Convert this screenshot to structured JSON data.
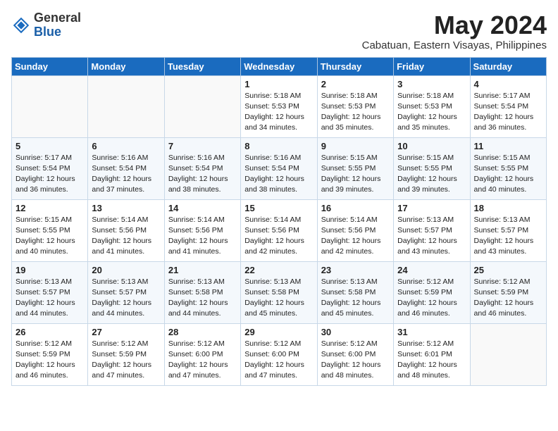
{
  "header": {
    "logo_line1": "General",
    "logo_line2": "Blue",
    "month_year": "May 2024",
    "location": "Cabatuan, Eastern Visayas, Philippines"
  },
  "days_of_week": [
    "Sunday",
    "Monday",
    "Tuesday",
    "Wednesday",
    "Thursday",
    "Friday",
    "Saturday"
  ],
  "weeks": [
    [
      {
        "day": "",
        "info": ""
      },
      {
        "day": "",
        "info": ""
      },
      {
        "day": "",
        "info": ""
      },
      {
        "day": "1",
        "info": "Sunrise: 5:18 AM\nSunset: 5:53 PM\nDaylight: 12 hours\nand 34 minutes."
      },
      {
        "day": "2",
        "info": "Sunrise: 5:18 AM\nSunset: 5:53 PM\nDaylight: 12 hours\nand 35 minutes."
      },
      {
        "day": "3",
        "info": "Sunrise: 5:18 AM\nSunset: 5:53 PM\nDaylight: 12 hours\nand 35 minutes."
      },
      {
        "day": "4",
        "info": "Sunrise: 5:17 AM\nSunset: 5:54 PM\nDaylight: 12 hours\nand 36 minutes."
      }
    ],
    [
      {
        "day": "5",
        "info": "Sunrise: 5:17 AM\nSunset: 5:54 PM\nDaylight: 12 hours\nand 36 minutes."
      },
      {
        "day": "6",
        "info": "Sunrise: 5:16 AM\nSunset: 5:54 PM\nDaylight: 12 hours\nand 37 minutes."
      },
      {
        "day": "7",
        "info": "Sunrise: 5:16 AM\nSunset: 5:54 PM\nDaylight: 12 hours\nand 38 minutes."
      },
      {
        "day": "8",
        "info": "Sunrise: 5:16 AM\nSunset: 5:54 PM\nDaylight: 12 hours\nand 38 minutes."
      },
      {
        "day": "9",
        "info": "Sunrise: 5:15 AM\nSunset: 5:55 PM\nDaylight: 12 hours\nand 39 minutes."
      },
      {
        "day": "10",
        "info": "Sunrise: 5:15 AM\nSunset: 5:55 PM\nDaylight: 12 hours\nand 39 minutes."
      },
      {
        "day": "11",
        "info": "Sunrise: 5:15 AM\nSunset: 5:55 PM\nDaylight: 12 hours\nand 40 minutes."
      }
    ],
    [
      {
        "day": "12",
        "info": "Sunrise: 5:15 AM\nSunset: 5:55 PM\nDaylight: 12 hours\nand 40 minutes."
      },
      {
        "day": "13",
        "info": "Sunrise: 5:14 AM\nSunset: 5:56 PM\nDaylight: 12 hours\nand 41 minutes."
      },
      {
        "day": "14",
        "info": "Sunrise: 5:14 AM\nSunset: 5:56 PM\nDaylight: 12 hours\nand 41 minutes."
      },
      {
        "day": "15",
        "info": "Sunrise: 5:14 AM\nSunset: 5:56 PM\nDaylight: 12 hours\nand 42 minutes."
      },
      {
        "day": "16",
        "info": "Sunrise: 5:14 AM\nSunset: 5:56 PM\nDaylight: 12 hours\nand 42 minutes."
      },
      {
        "day": "17",
        "info": "Sunrise: 5:13 AM\nSunset: 5:57 PM\nDaylight: 12 hours\nand 43 minutes."
      },
      {
        "day": "18",
        "info": "Sunrise: 5:13 AM\nSunset: 5:57 PM\nDaylight: 12 hours\nand 43 minutes."
      }
    ],
    [
      {
        "day": "19",
        "info": "Sunrise: 5:13 AM\nSunset: 5:57 PM\nDaylight: 12 hours\nand 44 minutes."
      },
      {
        "day": "20",
        "info": "Sunrise: 5:13 AM\nSunset: 5:57 PM\nDaylight: 12 hours\nand 44 minutes."
      },
      {
        "day": "21",
        "info": "Sunrise: 5:13 AM\nSunset: 5:58 PM\nDaylight: 12 hours\nand 44 minutes."
      },
      {
        "day": "22",
        "info": "Sunrise: 5:13 AM\nSunset: 5:58 PM\nDaylight: 12 hours\nand 45 minutes."
      },
      {
        "day": "23",
        "info": "Sunrise: 5:13 AM\nSunset: 5:58 PM\nDaylight: 12 hours\nand 45 minutes."
      },
      {
        "day": "24",
        "info": "Sunrise: 5:12 AM\nSunset: 5:59 PM\nDaylight: 12 hours\nand 46 minutes."
      },
      {
        "day": "25",
        "info": "Sunrise: 5:12 AM\nSunset: 5:59 PM\nDaylight: 12 hours\nand 46 minutes."
      }
    ],
    [
      {
        "day": "26",
        "info": "Sunrise: 5:12 AM\nSunset: 5:59 PM\nDaylight: 12 hours\nand 46 minutes."
      },
      {
        "day": "27",
        "info": "Sunrise: 5:12 AM\nSunset: 5:59 PM\nDaylight: 12 hours\nand 47 minutes."
      },
      {
        "day": "28",
        "info": "Sunrise: 5:12 AM\nSunset: 6:00 PM\nDaylight: 12 hours\nand 47 minutes."
      },
      {
        "day": "29",
        "info": "Sunrise: 5:12 AM\nSunset: 6:00 PM\nDaylight: 12 hours\nand 47 minutes."
      },
      {
        "day": "30",
        "info": "Sunrise: 5:12 AM\nSunset: 6:00 PM\nDaylight: 12 hours\nand 48 minutes."
      },
      {
        "day": "31",
        "info": "Sunrise: 5:12 AM\nSunset: 6:01 PM\nDaylight: 12 hours\nand 48 minutes."
      },
      {
        "day": "",
        "info": ""
      }
    ]
  ]
}
